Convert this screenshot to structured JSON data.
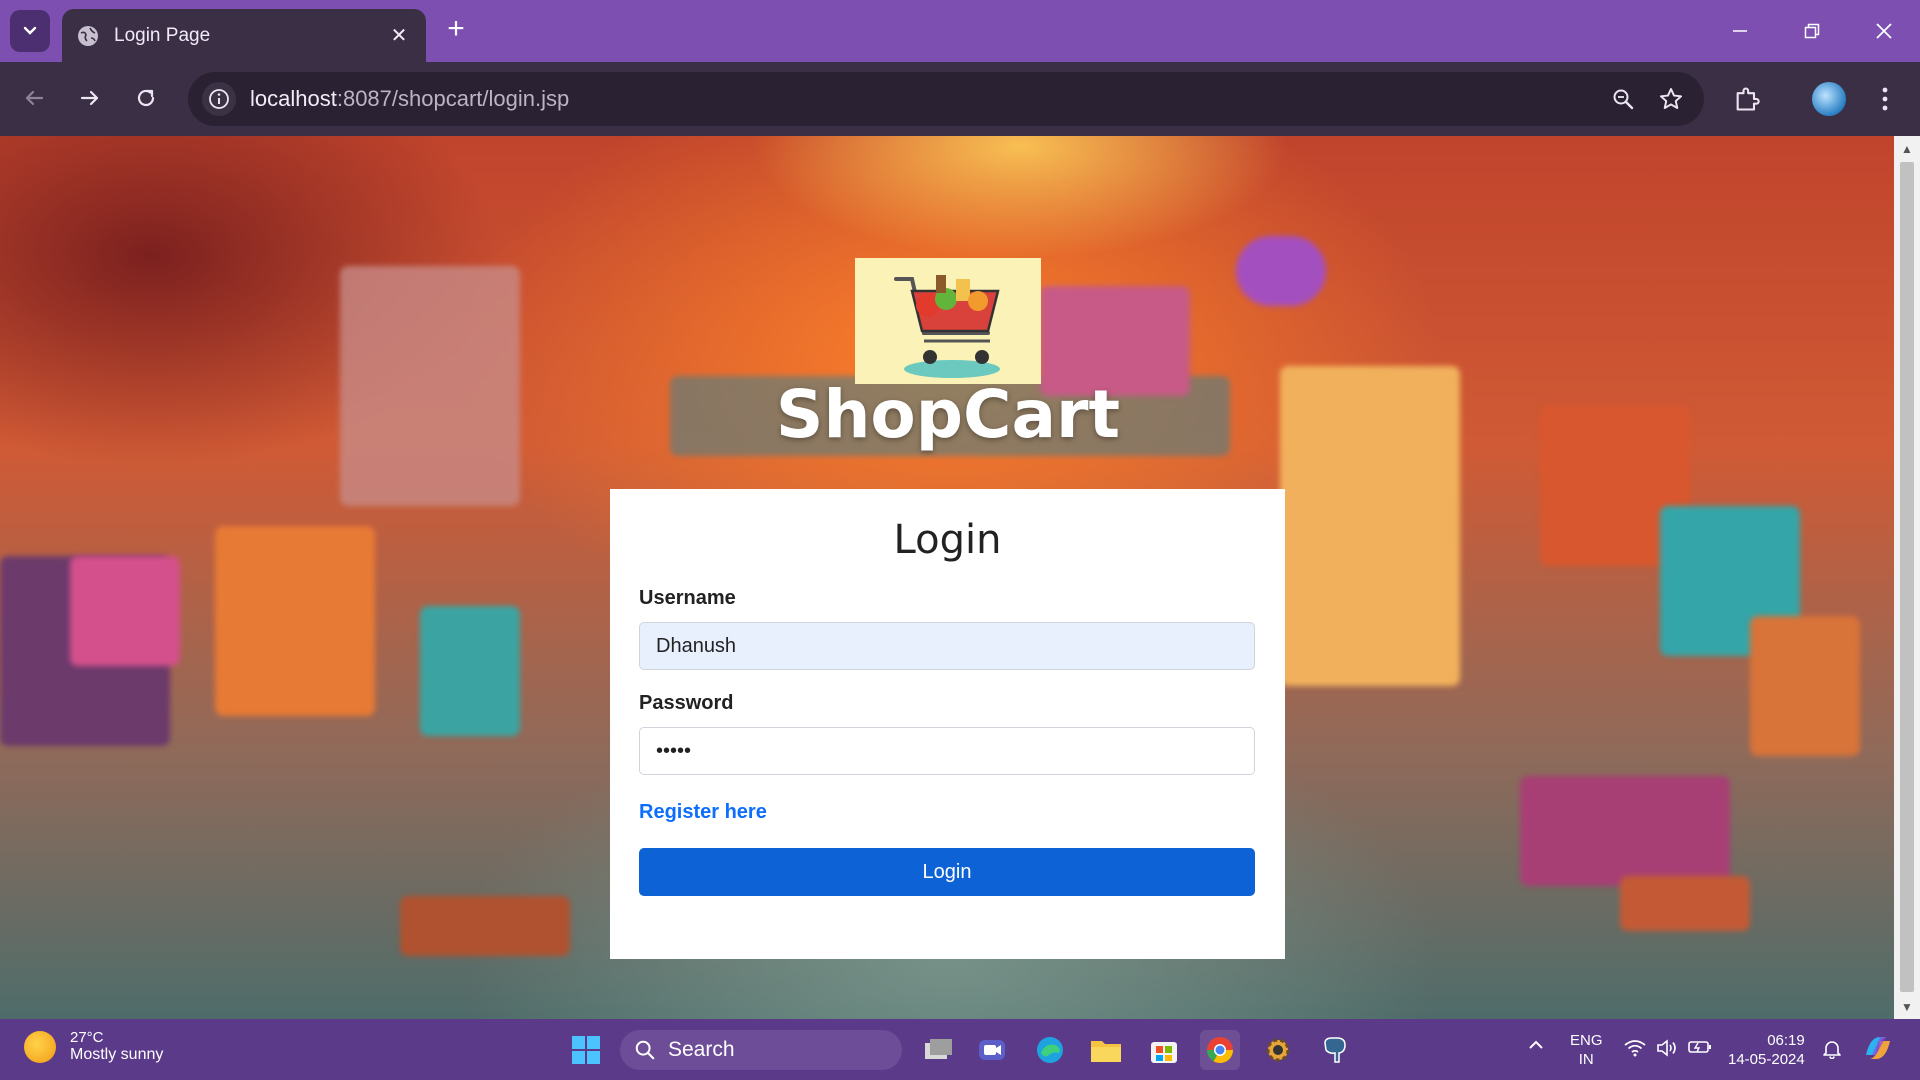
{
  "browser": {
    "tab_title": "Login Page",
    "url_host": "localhost",
    "url_rest": ":8087/shopcart/login.jsp"
  },
  "page": {
    "brand": "ShopCart",
    "heading": "Login",
    "username_label": "Username",
    "username_value": "Dhanush",
    "password_label": "Password",
    "password_value": "•••••",
    "register_link": "Register here",
    "login_button": "Login"
  },
  "taskbar": {
    "weather_temp": "27°C",
    "weather_desc": "Mostly sunny",
    "search_placeholder": "Search",
    "lang_top": "ENG",
    "lang_bottom": "IN",
    "time": "06:19",
    "date": "14-05-2024"
  },
  "colors": {
    "accent": "#0d62d6",
    "link": "#0d6efd",
    "tabbar": "#7c4fb0",
    "taskbar": "#5b3a8a"
  }
}
